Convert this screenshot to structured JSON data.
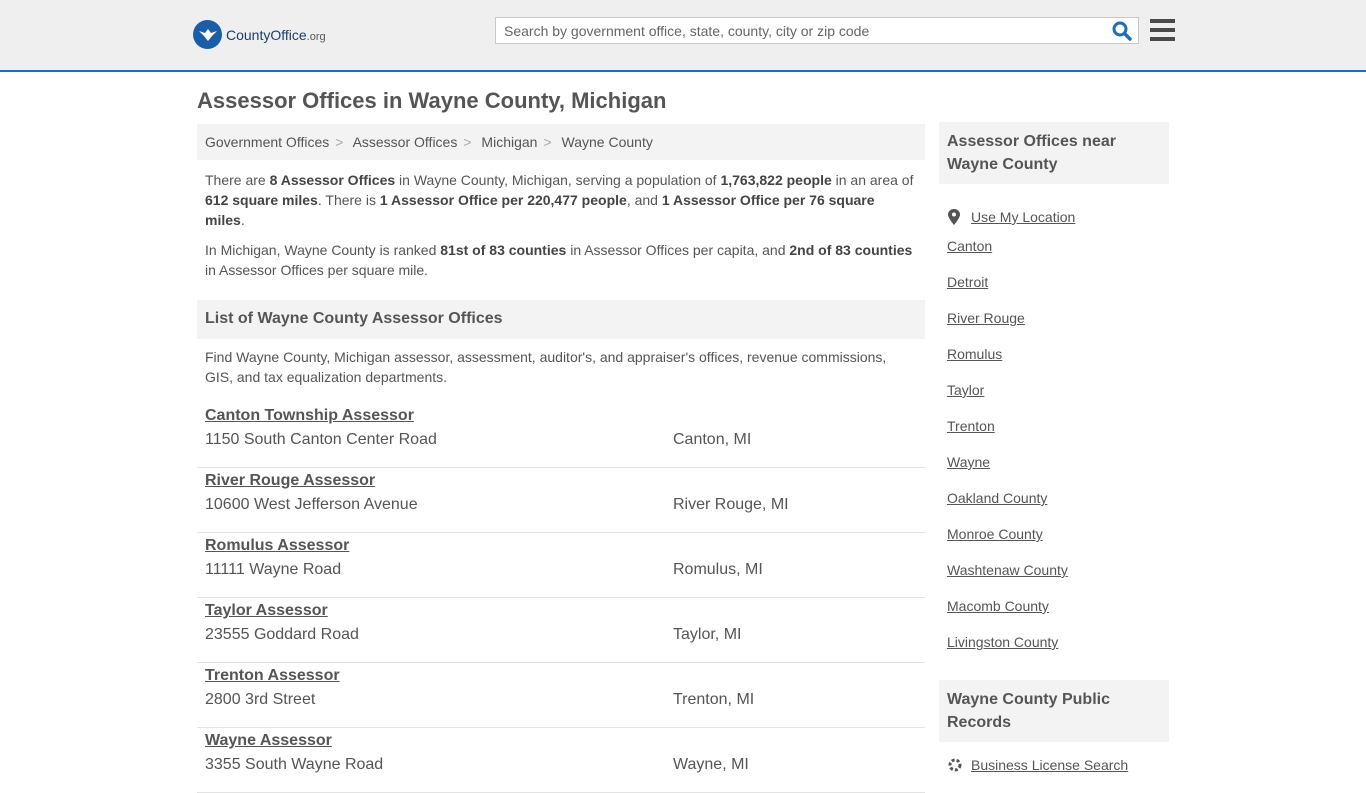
{
  "header": {
    "logo_main": "CountyOffice",
    "logo_suffix": ".org",
    "search_placeholder": "Search by government office, state, county, city or zip code"
  },
  "page_title": "Assessor Offices in Wayne County, Michigan",
  "breadcrumb": [
    "Government Offices",
    "Assessor Offices",
    "Michigan",
    "Wayne County"
  ],
  "intro": {
    "p1": [
      "There are ",
      "8 Assessor Offices",
      " in Wayne County, Michigan, serving a population of ",
      "1,763,822 people",
      " in an area of ",
      "612 square miles",
      ". There is ",
      "1 Assessor Office per 220,477 people",
      ", and ",
      "1 Assessor Office per 76 square miles",
      "."
    ],
    "p2": [
      "In Michigan, Wayne County is ranked ",
      "81st of 83 counties",
      " in Assessor Offices per capita, and ",
      "2nd of 83 counties",
      " in Assessor Offices per square mile."
    ]
  },
  "list_heading": "List of Wayne County Assessor Offices",
  "list_description": "Find Wayne County, Michigan assessor, assessment, auditor's, and appraiser's offices, revenue commissions, GIS, and tax equalization departments.",
  "offices": [
    {
      "name": "Canton Township Assessor",
      "address": "1150 South Canton Center Road",
      "city": "Canton, MI"
    },
    {
      "name": "River Rouge Assessor",
      "address": "10600 West Jefferson Avenue",
      "city": "River Rouge, MI"
    },
    {
      "name": "Romulus Assessor",
      "address": "11111 Wayne Road",
      "city": "Romulus, MI"
    },
    {
      "name": "Taylor Assessor",
      "address": "23555 Goddard Road",
      "city": "Taylor, MI"
    },
    {
      "name": "Trenton Assessor",
      "address": "2800 3rd Street",
      "city": "Trenton, MI"
    },
    {
      "name": "Wayne Assessor",
      "address": "3355 South Wayne Road",
      "city": "Wayne, MI"
    }
  ],
  "sidebar": {
    "nearby_title": "Assessor Offices near Wayne County",
    "use_location": "Use My Location",
    "links": [
      "Canton",
      "Detroit",
      "River Rouge",
      "Romulus",
      "Taylor",
      "Trenton",
      "Wayne",
      "Oakland County",
      "Monroe County",
      "Washtenaw County",
      "Macomb County",
      "Livingston County"
    ],
    "records_title": "Wayne County Public Records",
    "records_first_link": "Business License Search"
  },
  "colors": {
    "brand_blue": "#1a5ea8",
    "search_icon": "#1f6fb2"
  }
}
